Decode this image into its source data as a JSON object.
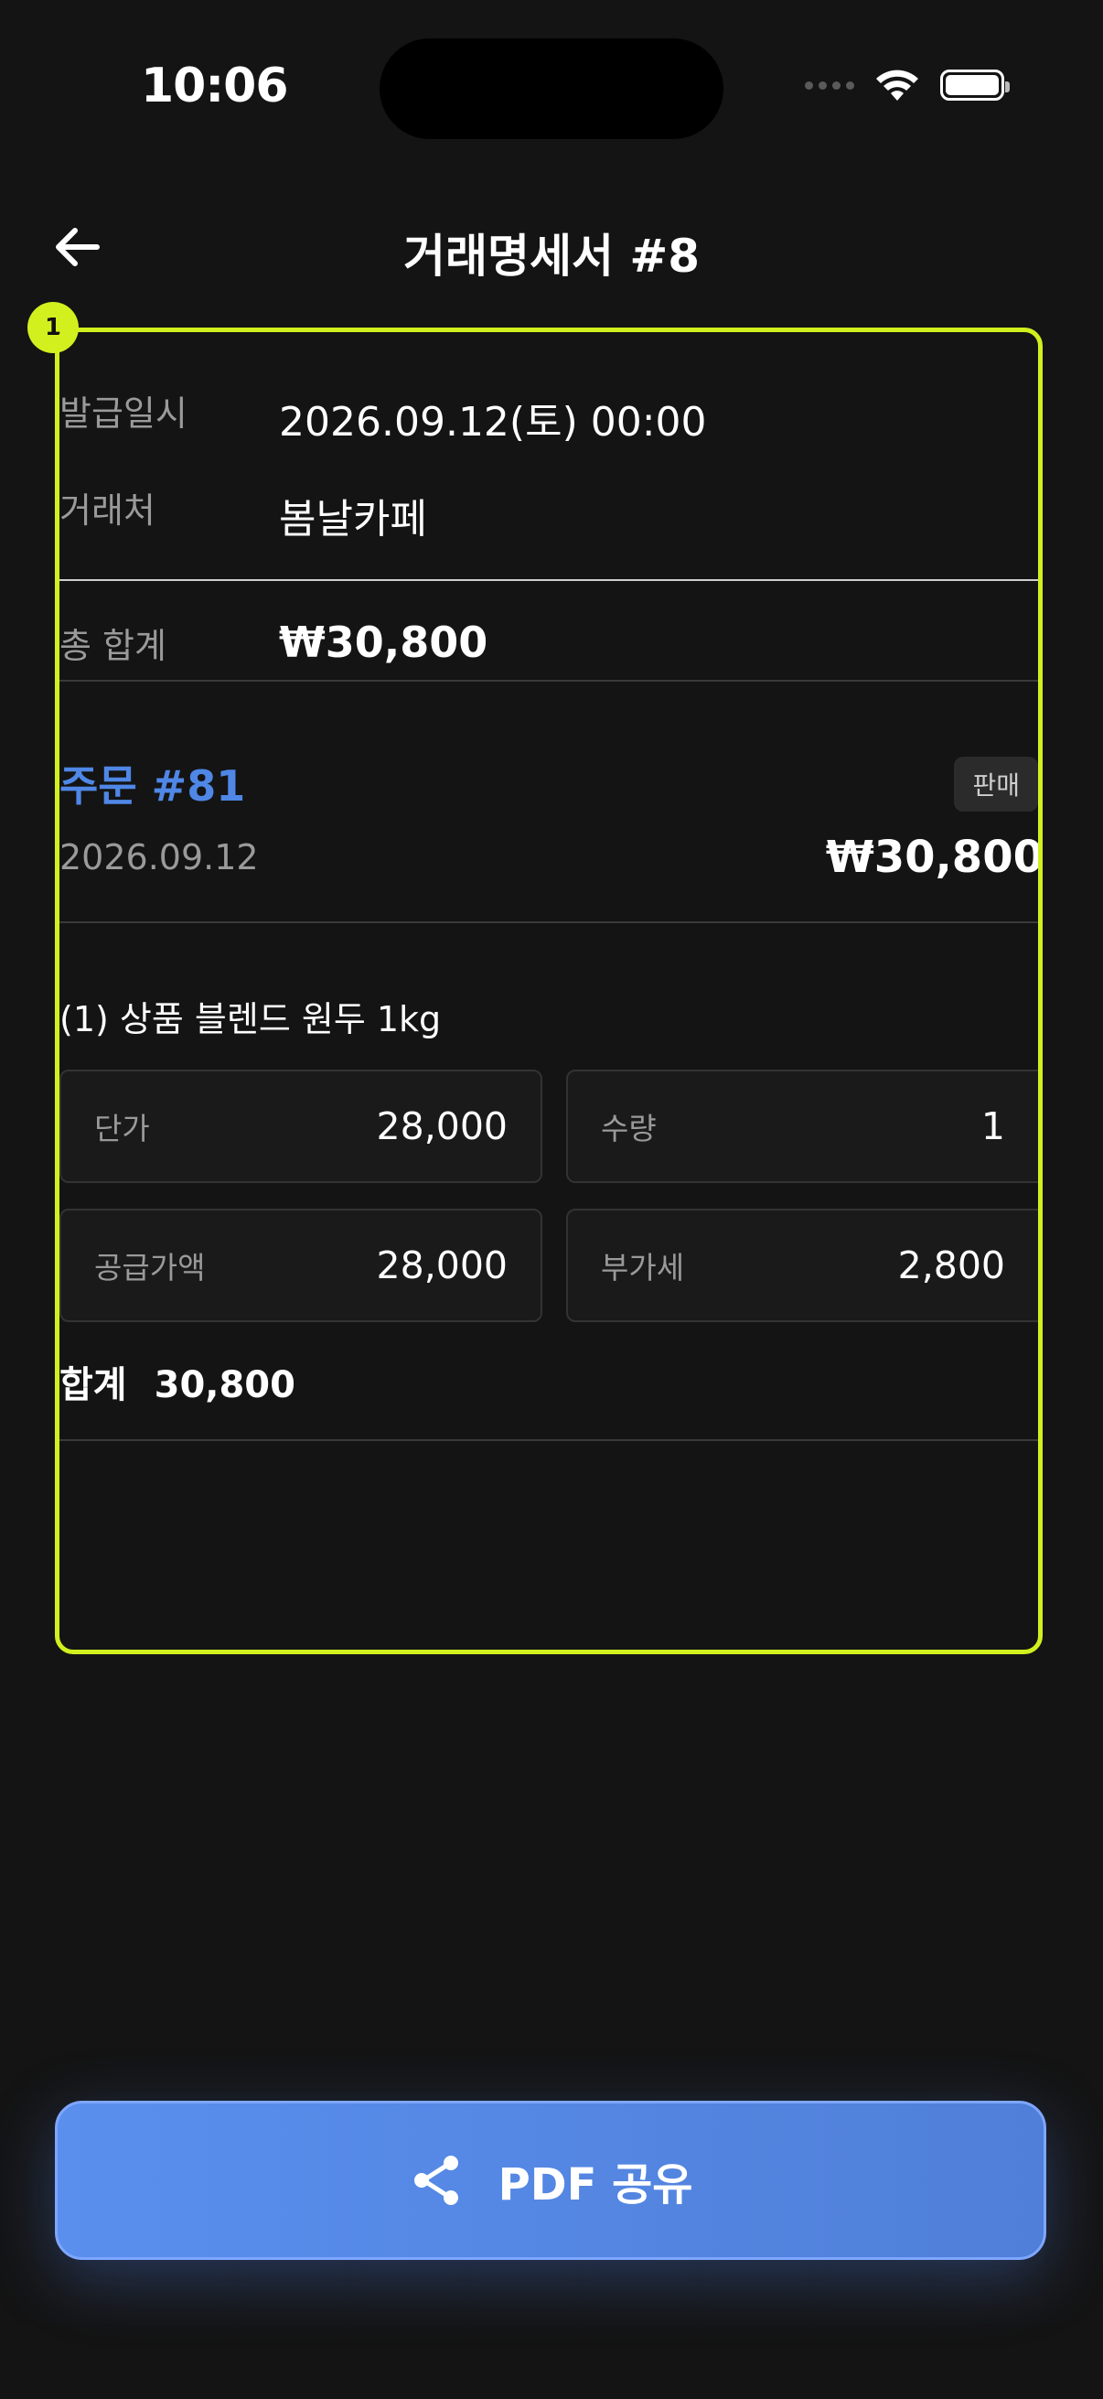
{
  "status": {
    "time": "10:06"
  },
  "header": {
    "title": "거래명세서 #8"
  },
  "annotation": {
    "number": "1"
  },
  "invoice": {
    "issue_label": "발급일시",
    "issue_value": "2026.09.12(토) 00:00",
    "client_label": "거래처",
    "client_value": "봄날카페",
    "total_label": "총 합계",
    "total_value": "₩30,800"
  },
  "order": {
    "title": "주문 #81",
    "tag": "판매",
    "date": "2026.09.12",
    "amount": "₩30,800"
  },
  "item": {
    "title": "(1) 상품   블렌드 원두 1kg",
    "unit_price_label": "단가",
    "unit_price_value": "28,000",
    "qty_label": "수량",
    "qty_value": "1",
    "supply_label": "공급가액",
    "supply_value": "28,000",
    "vat_label": "부가세",
    "vat_value": "2,800",
    "sum_label": "합계",
    "sum_value": "30,800"
  },
  "actions": {
    "pdf_share": "PDF 공유"
  },
  "colors": {
    "accent": "#d2f01e",
    "primary": "#4f87e6",
    "background": "#141414"
  },
  "icons": {
    "back": "arrow-left-icon",
    "share": "share-icon",
    "wifi": "wifi-icon",
    "battery": "battery-icon"
  }
}
